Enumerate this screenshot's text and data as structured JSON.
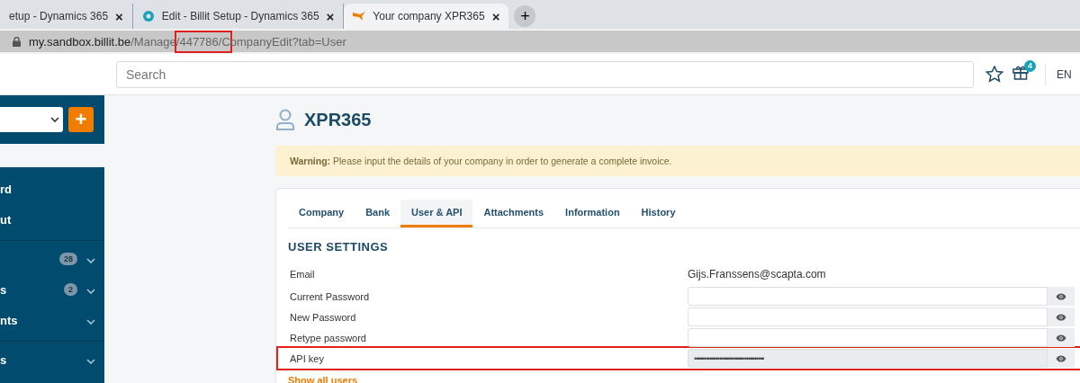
{
  "browser": {
    "tabs": [
      {
        "title": "etup - Dynamics 365",
        "selected": false
      },
      {
        "title": "Edit - Billit Setup - Dynamics 365",
        "selected": false
      },
      {
        "title": "Your company XPR365",
        "selected": true
      }
    ],
    "new_tab": "+",
    "close": "×",
    "address_bar": {
      "host": "my.sandbox.billit.be",
      "path_before": "/Manage",
      "path_marked": "/447786/C",
      "path_after": "ompanyEdit?tab=User",
      "highlighted": true
    }
  },
  "header": {
    "search": {
      "placeholder": "Search"
    },
    "gift_badge": "4",
    "language": "EN"
  },
  "sidebar": {
    "add_button": "+",
    "groups": [
      [
        {
          "label": "rd"
        },
        {
          "label": "ut"
        }
      ],
      [
        {
          "badge": "28",
          "expanded": false
        },
        {
          "label": "s",
          "badge": "2",
          "expanded": false
        },
        {
          "label": "nts",
          "expanded": false
        }
      ],
      [
        {
          "label": "s",
          "expanded": false
        }
      ]
    ]
  },
  "page": {
    "title": "XPR365",
    "warning": {
      "label": "Warning:",
      "text": "Please input the details of your company in order to generate a complete invoice."
    },
    "tabs": [
      {
        "label": "Company",
        "selected": false
      },
      {
        "label": "Bank",
        "selected": false
      },
      {
        "label": "User & API",
        "selected": true
      },
      {
        "label": "Attachments",
        "selected": false
      },
      {
        "label": "Information",
        "selected": false
      },
      {
        "label": "History",
        "selected": false
      }
    ],
    "section_title": "USER SETTINGS",
    "rows": [
      {
        "kind": "text",
        "label": "Email",
        "value": "Gijs.Franssens@scapta.com",
        "highlighted": false
      },
      {
        "kind": "password",
        "label": "Current Password",
        "value": "",
        "readonly": false,
        "highlighted": false
      },
      {
        "kind": "password",
        "label": "New Password",
        "value": "",
        "readonly": false,
        "highlighted": false
      },
      {
        "kind": "password",
        "label": "Retype password",
        "value": "",
        "readonly": false,
        "highlighted": false
      },
      {
        "kind": "password",
        "label": "API key",
        "value": "••••••••••••••••••••••••••••••••••••",
        "readonly": true,
        "highlighted": true
      }
    ],
    "link": "Show all users"
  }
}
